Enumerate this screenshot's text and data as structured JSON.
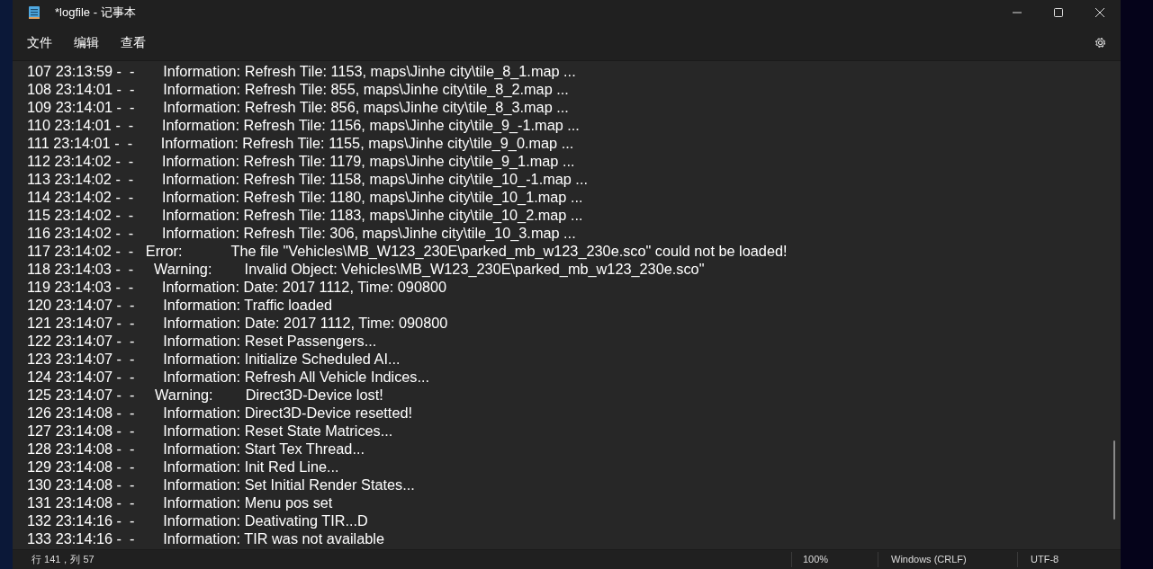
{
  "window": {
    "title": "*logfile - 记事本"
  },
  "menu": [
    "文件",
    "编辑",
    "查看"
  ],
  "lines": [
    "107 23:13:59 -  -       Information: Refresh Tile: 1153, maps\\Jinhe city\\tile_8_1.map ...",
    "108 23:14:01 -  -       Information: Refresh Tile: 855, maps\\Jinhe city\\tile_8_2.map ...",
    "109 23:14:01 -  -       Information: Refresh Tile: 856, maps\\Jinhe city\\tile_8_3.map ...",
    "110 23:14:01 -  -       Information: Refresh Tile: 1156, maps\\Jinhe city\\tile_9_-1.map ...",
    "111 23:14:01 -  -       Information: Refresh Tile: 1155, maps\\Jinhe city\\tile_9_0.map ...",
    "112 23:14:02 -  -       Information: Refresh Tile: 1179, maps\\Jinhe city\\tile_9_1.map ...",
    "113 23:14:02 -  -       Information: Refresh Tile: 1158, maps\\Jinhe city\\tile_10_-1.map ...",
    "114 23:14:02 -  -       Information: Refresh Tile: 1180, maps\\Jinhe city\\tile_10_1.map ...",
    "115 23:14:02 -  -       Information: Refresh Tile: 1183, maps\\Jinhe city\\tile_10_2.map ...",
    "116 23:14:02 -  -       Information: Refresh Tile: 306, maps\\Jinhe city\\tile_10_3.map ...",
    "117 23:14:02 -  -   Error:            The file \"Vehicles\\MB_W123_230E\\parked_mb_w123_230e.sco\" could not be loaded!",
    "118 23:14:03 -  -     Warning:        Invalid Object: Vehicles\\MB_W123_230E\\parked_mb_w123_230e.sco\"",
    "119 23:14:03 -  -       Information: Date: 2017 1112, Time: 090800",
    "120 23:14:07 -  -       Information: Traffic loaded",
    "121 23:14:07 -  -       Information: Date: 2017 1112, Time: 090800",
    "122 23:14:07 -  -       Information: Reset Passengers...",
    "123 23:14:07 -  -       Information: Initialize Scheduled AI...",
    "124 23:14:07 -  -       Information: Refresh All Vehicle Indices...",
    "125 23:14:07 -  -     Warning:        Direct3D-Device lost!",
    "126 23:14:08 -  -       Information: Direct3D-Device resetted!",
    "127 23:14:08 -  -       Information: Reset State Matrices...",
    "128 23:14:08 -  -       Information: Start Tex Thread...",
    "129 23:14:08 -  -       Information: Init Red Line...",
    "130 23:14:08 -  -       Information: Set Initial Render States...",
    "131 23:14:08 -  -       Information: Menu pos set",
    "132 23:14:16 -  -       Information: Deativating TIR...D",
    "133 23:14:16 -  -       Information: TIR was not available"
  ],
  "status_bar": {
    "position": "行 141，列 57",
    "zoom": "100%",
    "line_ending": "Windows (CRLF)",
    "encoding": "UTF-8"
  }
}
